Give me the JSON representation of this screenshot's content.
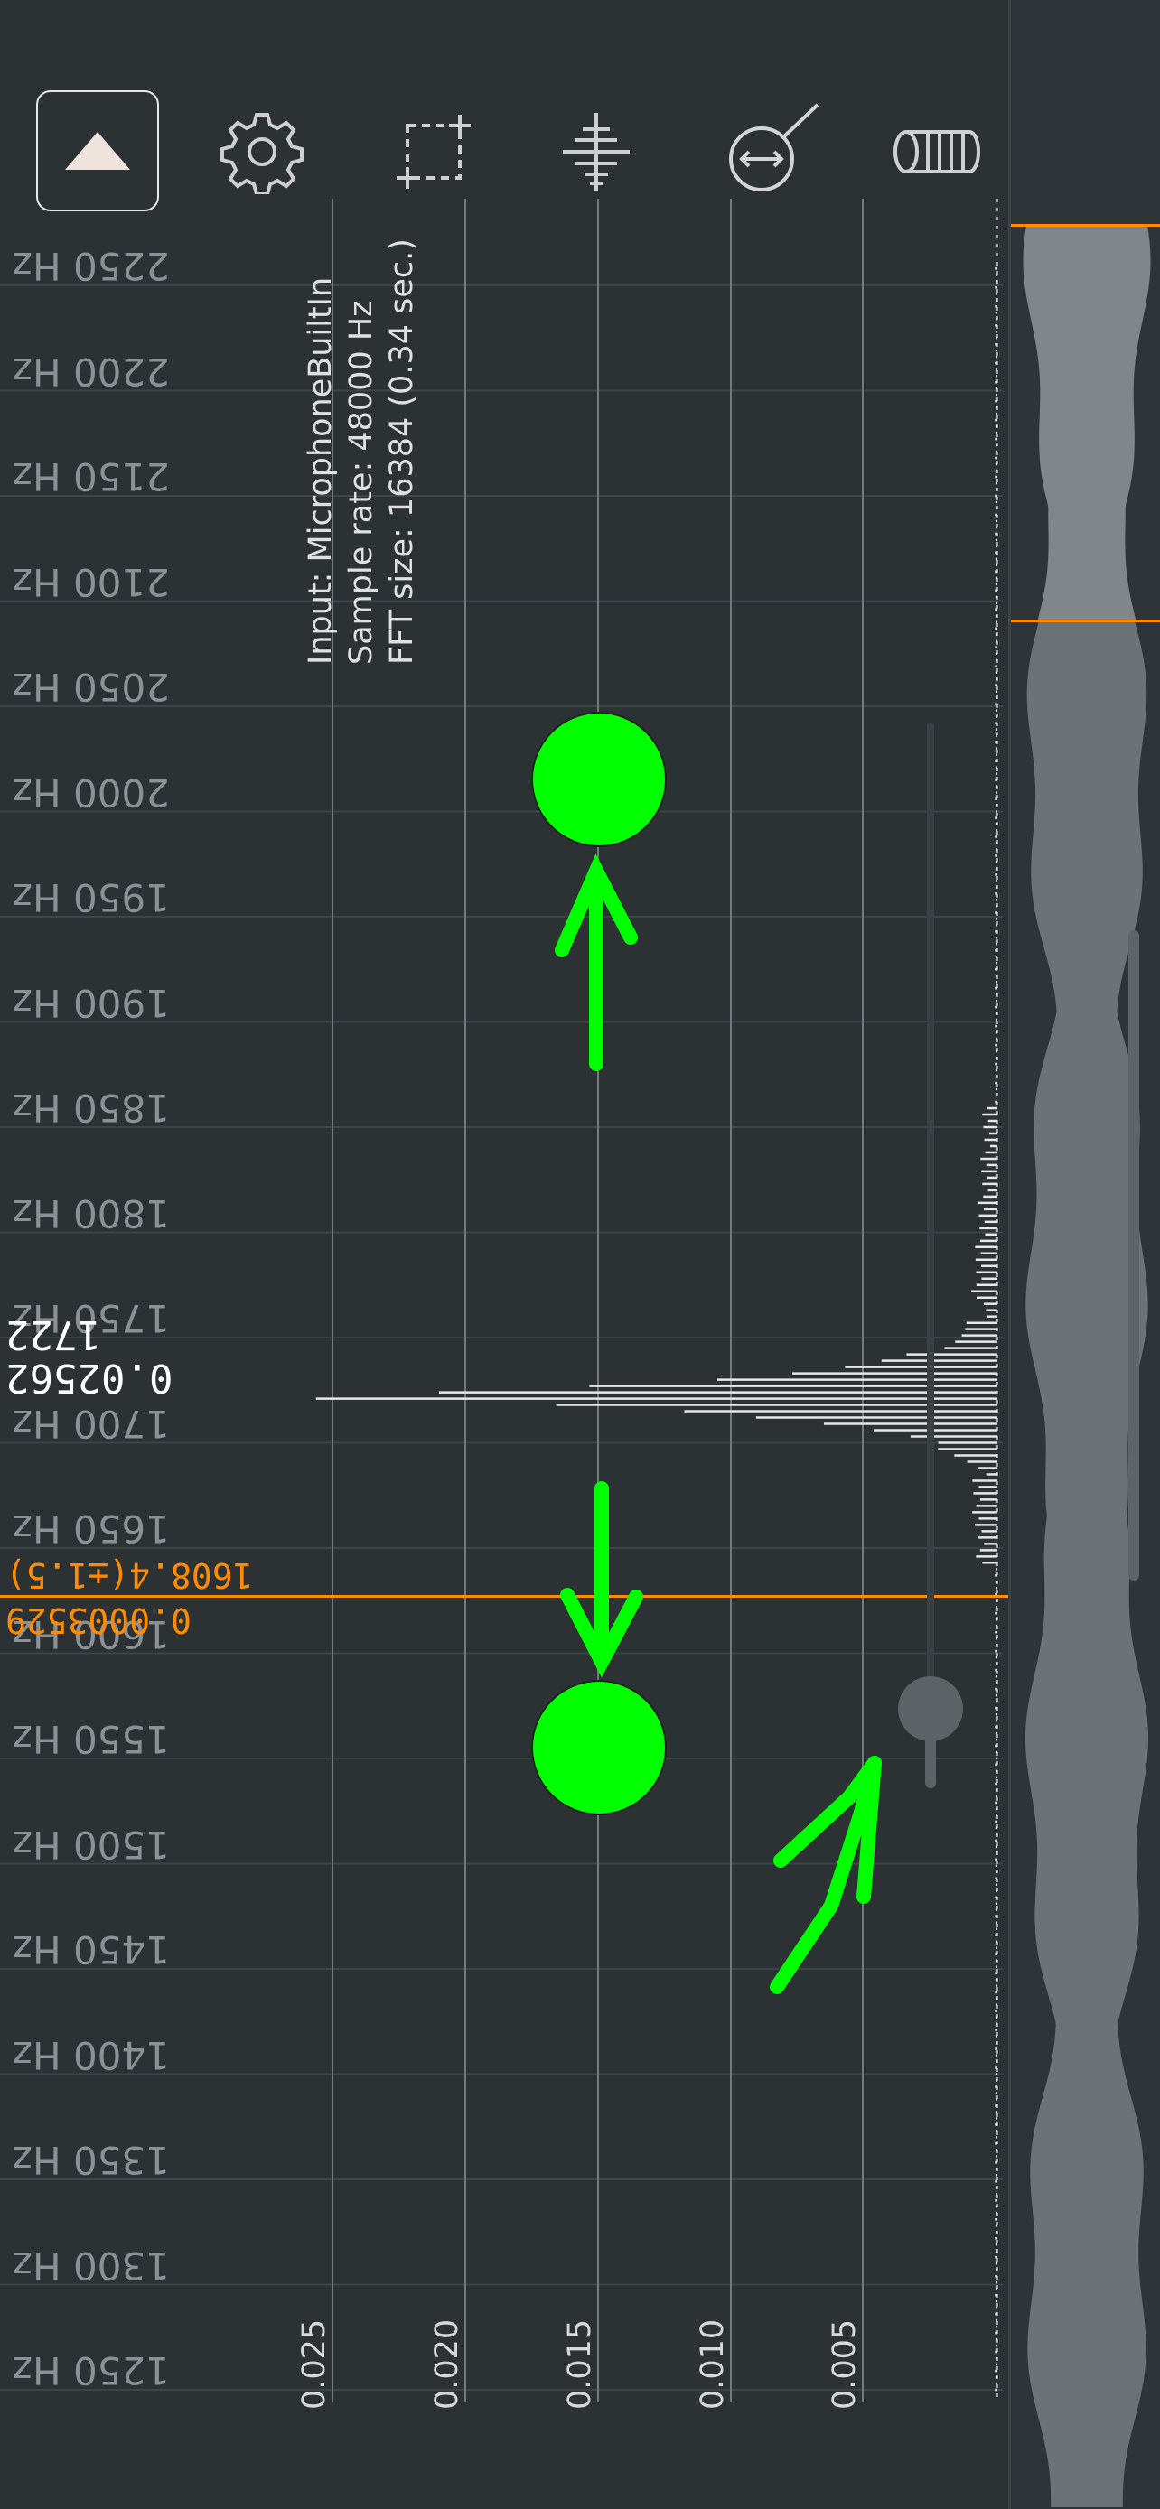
{
  "toolbar": {
    "buttons": [
      {
        "name": "collapse-button",
        "icon": "triangle-up-icon"
      },
      {
        "name": "settings-button",
        "icon": "gear-icon"
      },
      {
        "name": "selection-button",
        "icon": "select-rectangle-icon"
      },
      {
        "name": "waveform-button",
        "icon": "waveform-icon"
      },
      {
        "name": "zoom-button",
        "icon": "magnifier-resize-icon"
      },
      {
        "name": "clear-button",
        "icon": "eraser-icon"
      }
    ],
    "menu_icon": "more-vertical-icon"
  },
  "spectrum": {
    "frequency_labels": [
      "2250 Hz",
      "2200 Hz",
      "2150 Hz",
      "2100 Hz",
      "2050 Hz",
      "2000 Hz",
      "1950 Hz",
      "1900 Hz",
      "1850 Hz",
      "1800 Hz",
      "1750 Hz",
      "1700 Hz",
      "1650 Hz",
      "1600 Hz",
      "1550 Hz",
      "1500 Hz",
      "1450 Hz",
      "1400 Hz",
      "1350 Hz",
      "1300 Hz",
      "1250 Hz"
    ],
    "amplitude_labels": [
      "0.025",
      "0.020",
      "0.015",
      "0.010",
      "0.005"
    ],
    "info": {
      "input": "Input: MicrophoneBuiltIn",
      "sample_rate": "Sample rate: 48000 Hz",
      "fft_size": "FFT size: 16384 (0.34 sec.)"
    },
    "peak": {
      "frequency": "1722",
      "amplitude": "0.02562"
    },
    "cursor": {
      "frequency": "1608.4(±1.5)",
      "amplitude": "0.0003529"
    }
  },
  "colors": {
    "background": "#2c3134",
    "accent": "#ff8c00",
    "annotation": "#00ff00",
    "waveform": "#6c7276",
    "waveform_selected": "#80868a"
  }
}
